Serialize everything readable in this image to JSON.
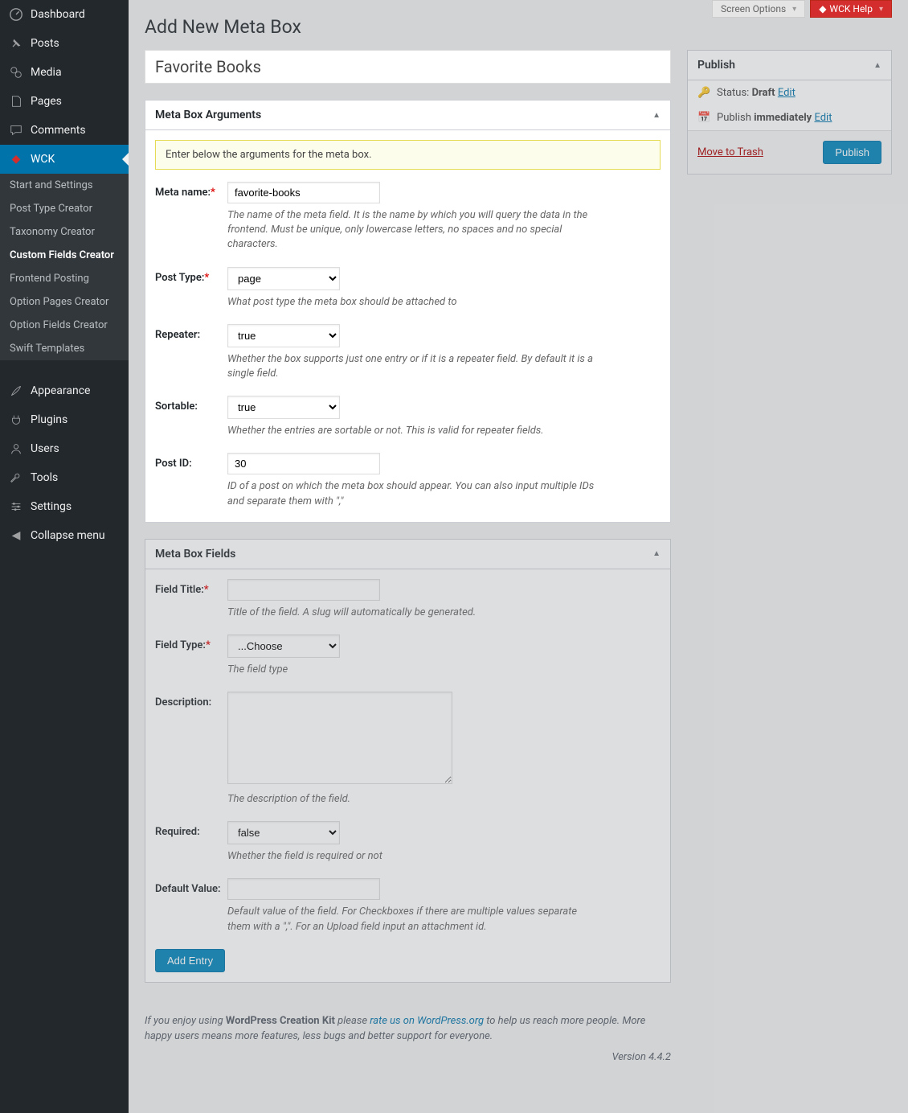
{
  "topbar": {
    "screen_options": "Screen Options",
    "help": "WCK Help"
  },
  "sidebar": {
    "dashboard": "Dashboard",
    "posts": "Posts",
    "media": "Media",
    "pages": "Pages",
    "comments": "Comments",
    "wck": "WCK",
    "wck_sub": {
      "start": "Start and Settings",
      "ptc": "Post Type Creator",
      "tc": "Taxonomy Creator",
      "cfc": "Custom Fields Creator",
      "fp": "Frontend Posting",
      "opc": "Option Pages Creator",
      "ofc": "Option Fields Creator",
      "st": "Swift Templates"
    },
    "appearance": "Appearance",
    "plugins": "Plugins",
    "users": "Users",
    "tools": "Tools",
    "settings": "Settings",
    "collapse": "Collapse menu"
  },
  "page_title": "Add New Meta Box",
  "title_field": {
    "value": "Favorite Books"
  },
  "box_args": {
    "heading": "Meta Box Arguments",
    "notice": "Enter below the arguments for the meta box.",
    "meta_name": {
      "label": "Meta name:",
      "value": "favorite-books",
      "help": "The name of the meta field. It is the name by which you will query the data in the frontend. Must be unique, only lowercase letters, no spaces and no special characters."
    },
    "post_type": {
      "label": "Post Type:",
      "value": "page",
      "help": "What post type the meta box should be attached to"
    },
    "repeater": {
      "label": "Repeater:",
      "value": "true",
      "help": "Whether the box supports just one entry or if it is a repeater field. By default it is a single field."
    },
    "sortable": {
      "label": "Sortable:",
      "value": "true",
      "help": "Whether the entries are sortable or not. This is valid for repeater fields."
    },
    "post_id": {
      "label": "Post ID:",
      "value": "30",
      "help": "ID of a post on which the meta box should appear. You can also input multiple IDs and separate them with \",\""
    }
  },
  "box_fields": {
    "heading": "Meta Box Fields",
    "field_title": {
      "label": "Field Title:",
      "help": "Title of the field. A slug will automatically be generated."
    },
    "field_type": {
      "label": "Field Type:",
      "value": "...Choose",
      "help": "The field type"
    },
    "description": {
      "label": "Description:",
      "help": "The description of the field."
    },
    "required": {
      "label": "Required:",
      "value": "false",
      "help": "Whether the field is required or not"
    },
    "default": {
      "label": "Default Value:",
      "help": "Default value of the field. For Checkboxes if there are multiple values separate them with a \",\". For an Upload field input an attachment id."
    },
    "add_btn": "Add Entry"
  },
  "publish": {
    "heading": "Publish",
    "status_pre": "Status:",
    "status_val": "Draft",
    "status_edit": "Edit",
    "pub_pre": "Publish",
    "pub_val": "immediately",
    "pub_edit": "Edit",
    "trash": "Move to Trash",
    "btn": "Publish"
  },
  "footer": {
    "t1": "If you enjoy using ",
    "t2": "WordPress Creation Kit",
    "t3": " please ",
    "t4": "rate us on WordPress.org",
    "t5": " to help us reach more people. More happy users means more features, less bugs and better support for everyone.",
    "version": "Version 4.4.2"
  }
}
